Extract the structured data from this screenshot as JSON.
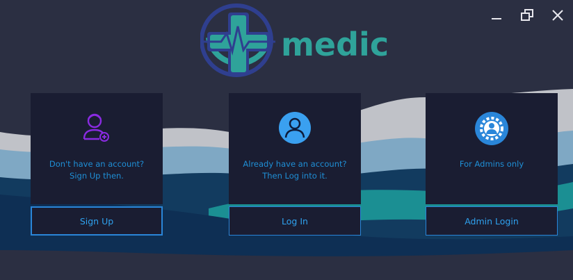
{
  "app": {
    "logo_text": "medic"
  },
  "cards": [
    {
      "line1": "Don't have an account?",
      "line2": "Sign Up then.",
      "button": "Sign Up",
      "icon": "user-add-icon"
    },
    {
      "line1": "Already have an account?",
      "line2": "Then Log into it.",
      "button": "Log In",
      "icon": "user-circle-icon"
    },
    {
      "line1": "For Admins only",
      "line2": "",
      "button": "Admin Login",
      "icon": "admin-gear-icon"
    }
  ],
  "colors": {
    "background": "#2b2f42",
    "card": "#1a1d32",
    "accent_blue": "#2a86d9",
    "text_blue": "#1f8fd6",
    "logo_teal": "#2fa39a",
    "logo_navy": "#2f3f8f",
    "icon_purple": "#8a2be2"
  }
}
